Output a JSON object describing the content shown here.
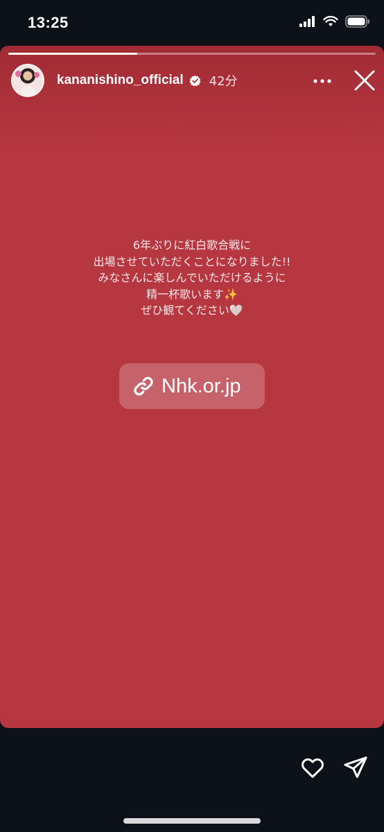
{
  "status_bar": {
    "time": "13:25",
    "icons": [
      "cellular-signal-icon",
      "wifi-icon",
      "battery-icon"
    ]
  },
  "story": {
    "progress": 0.35,
    "username": "kananishino_official",
    "verified": true,
    "time_ago": "42分",
    "background_color": "#b73740",
    "message_lines": [
      "6年ぶりに紅白歌合戦に",
      "出場させていただくことになりました!!",
      "みなさんに楽しんでいただけるように",
      "精一杯歌います✨",
      "ぜひ観てください🤍"
    ],
    "link_sticker": {
      "label": "Nhk.or.jp",
      "icon": "link-icon"
    }
  },
  "actions": {
    "icons": [
      "more-icon",
      "close-icon",
      "heart-icon",
      "send-icon"
    ]
  }
}
